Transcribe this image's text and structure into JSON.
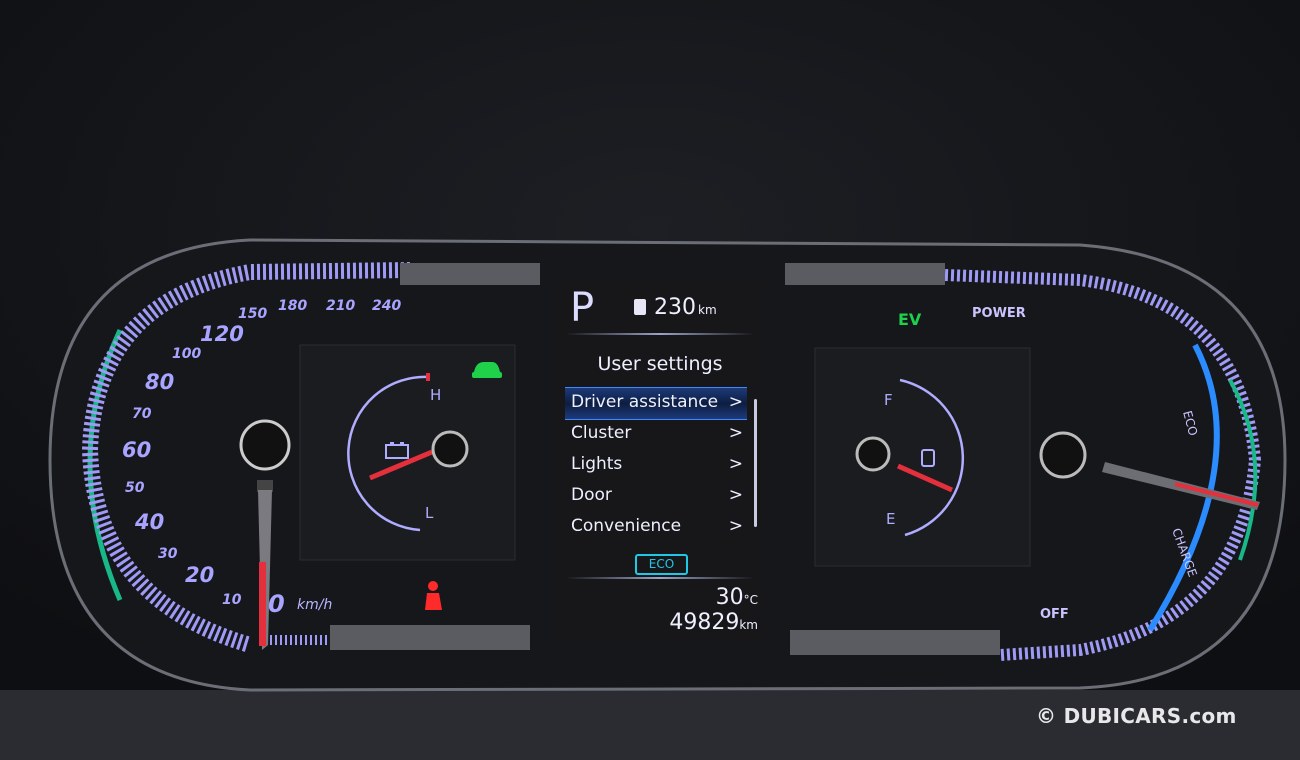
{
  "speedometer": {
    "labels": [
      "0",
      "10",
      "20",
      "30",
      "40",
      "50",
      "60",
      "70",
      "80",
      "100",
      "120",
      "150",
      "180",
      "210",
      "240"
    ],
    "unit": "km/h",
    "speed_kmh": 0
  },
  "temp_gauge": {
    "high_label": "H",
    "low_label": "L",
    "icon": "battery-icon"
  },
  "fuel_gauge": {
    "full_label": "F",
    "empty_label": "E",
    "icon": "fuel-pump-icon"
  },
  "power_gauge": {
    "ev_label": "EV",
    "power_label": "POWER",
    "eco_label": "ECO",
    "charge_label": "CHARGE",
    "off_label": "OFF"
  },
  "indicators": {
    "car_icon": "car-lift-icon",
    "seatbelt_icon": "seatbelt-warning-icon"
  },
  "screen": {
    "gear": "P",
    "range_value": "230",
    "range_unit": "km",
    "title": "User settings",
    "menu": [
      {
        "label": "Driver assistance",
        "selected": true
      },
      {
        "label": "Cluster"
      },
      {
        "label": "Lights"
      },
      {
        "label": "Door"
      },
      {
        "label": "Convenience"
      }
    ],
    "chevron": ">",
    "drive_mode": "ECO",
    "temperature": "30",
    "temperature_unit": "°C",
    "odometer": "49829",
    "odometer_unit": "km"
  },
  "watermark": "© DUBICARS.com",
  "colors": {
    "lavender": "#a9a4ff",
    "needle": "#e3303c",
    "ev_green": "#1fd14a",
    "eco_cyan": "#21c8e6"
  }
}
